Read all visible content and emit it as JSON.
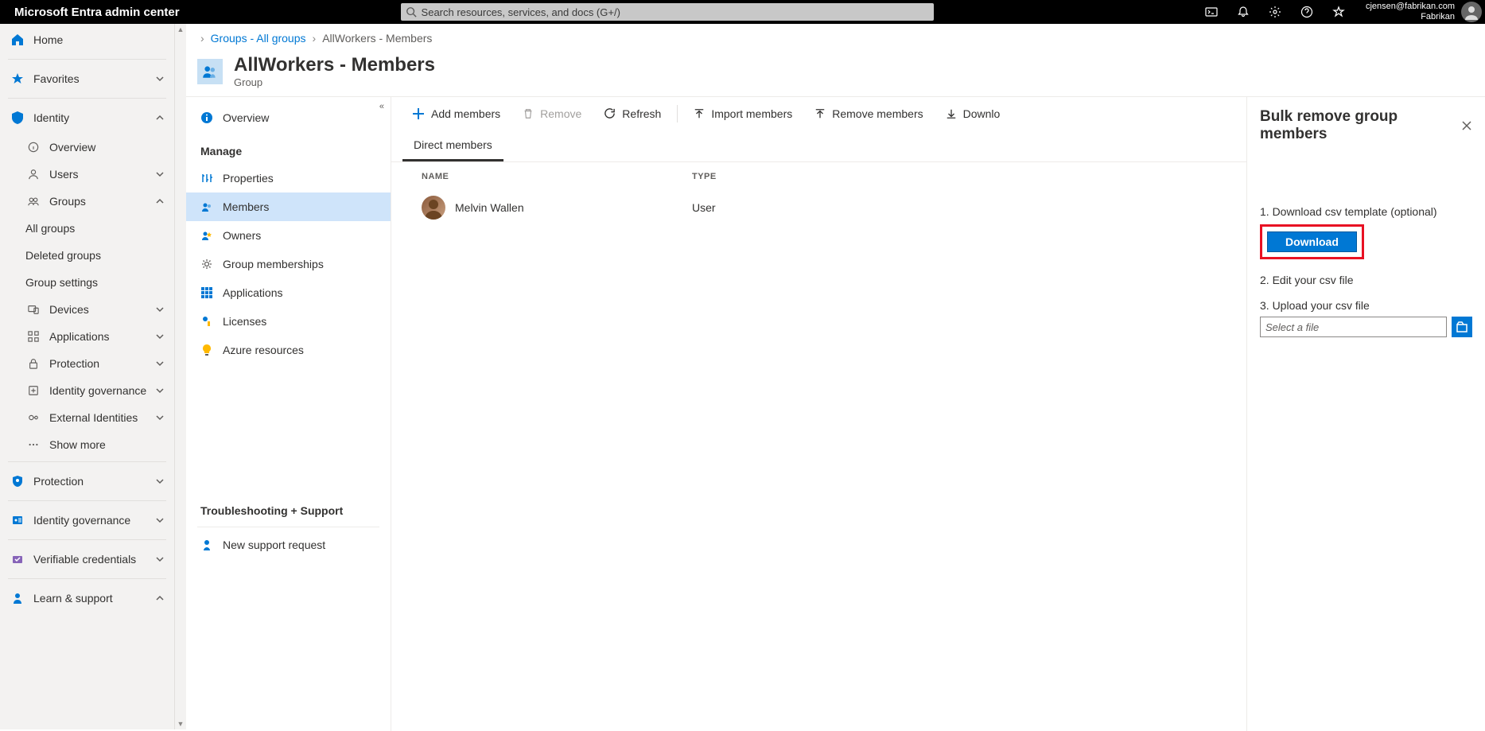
{
  "topbar": {
    "brand": "Microsoft Entra admin center",
    "search_placeholder": "Search resources, services, and docs (G+/)",
    "account_email": "cjensen@fabrikan.com",
    "account_org": "Fabrikan"
  },
  "leftnav": {
    "home": "Home",
    "favorites": "Favorites",
    "identity": "Identity",
    "overview": "Overview",
    "users": "Users",
    "groups": "Groups",
    "all_groups": "All groups",
    "deleted_groups": "Deleted groups",
    "group_settings": "Group settings",
    "devices": "Devices",
    "applications": "Applications",
    "protection": "Protection",
    "identity_gov": "Identity governance",
    "external": "External Identities",
    "show_more": "Show more",
    "protection2": "Protection",
    "identity_gov2": "Identity governance",
    "verifiable": "Verifiable credentials",
    "learn_support": "Learn & support"
  },
  "breadcrumb": {
    "groups": "Groups - All groups",
    "current": "AllWorkers - Members"
  },
  "page": {
    "title": "AllWorkers - Members",
    "subtitle": "Group"
  },
  "detailnav": {
    "overview": "Overview",
    "manage": "Manage",
    "properties": "Properties",
    "members": "Members",
    "owners": "Owners",
    "memberships": "Group memberships",
    "apps": "Applications",
    "licenses": "Licenses",
    "azure": "Azure resources",
    "trouble": "Troubleshooting + Support",
    "support": "New support request"
  },
  "toolbar": {
    "add": "Add members",
    "remove": "Remove",
    "refresh": "Refresh",
    "import": "Import members",
    "remove_members": "Remove members",
    "download": "Downlo"
  },
  "tabs": {
    "direct": "Direct members"
  },
  "table": {
    "col_name": "NAME",
    "col_type": "TYPE",
    "rows": [
      {
        "name": "Melvin Wallen",
        "type": "User"
      }
    ]
  },
  "panel": {
    "title": "Bulk remove group members",
    "step1": "1. Download csv template (optional)",
    "download_btn": "Download",
    "step2": "2. Edit your csv file",
    "step3": "3. Upload your csv file",
    "file_placeholder": "Select a file"
  }
}
